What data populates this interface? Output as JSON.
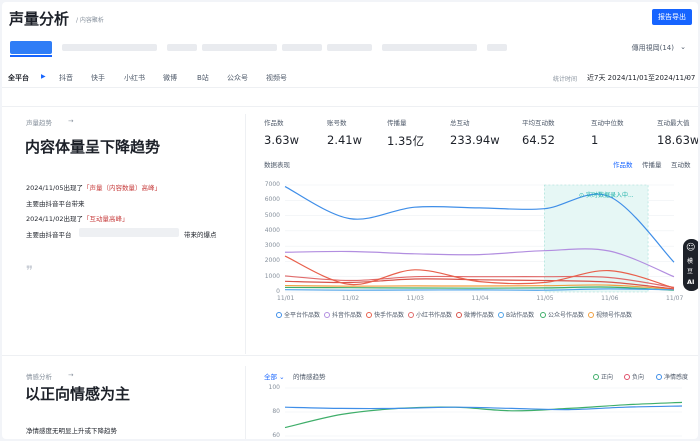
{
  "header": {
    "title": "声量分析",
    "subtitle": "/ 内容聚析",
    "export_label": "报告导出"
  },
  "accounts": {
    "selected_label": "傳用視岡(14)"
  },
  "tabs": [
    "全平台",
    "抖音",
    "快手",
    "小红书",
    "微博",
    "B站",
    "公众号",
    "视频号"
  ],
  "date": {
    "label": "统计时间",
    "range": "近7天  2024/11/01至2024/11/07"
  },
  "volume": {
    "tag": "声量趋势",
    "headline": "内容体量呈下降趋势",
    "bullets": [
      {
        "prefix": "2024/11/05出现了",
        "highlight": "「声量（内容数量）高峰」"
      },
      {
        "prefix": "主要由抖音平台带来",
        "highlight": ""
      },
      {
        "prefix": "2024/11/02出现了",
        "highlight": "「互动量高峰」"
      },
      {
        "prefix": "主要由抖音平台",
        "highlight": "",
        "suffix": "带来的爆点"
      }
    ],
    "stats": [
      {
        "label": "作品数",
        "value": "3.63w"
      },
      {
        "label": "账号数",
        "value": "2.41w"
      },
      {
        "label": "传播量",
        "value": "1.35亿"
      },
      {
        "label": "总互动",
        "value": "233.94w"
      },
      {
        "label": "平均互动数",
        "value": "64.52"
      },
      {
        "label": "互动中位数",
        "value": "1"
      },
      {
        "label": "互动最大值",
        "value": "18.63w"
      }
    ],
    "chart_title": "数据表现",
    "metric_tabs": [
      "作品数",
      "传播量",
      "互动数"
    ],
    "live_badge": "实时数据录入中..."
  },
  "chart_data": [
    {
      "type": "line",
      "title": "数据表现",
      "x": [
        "11/01",
        "11/02",
        "11/03",
        "11/04",
        "11/05",
        "11/06",
        "11/07"
      ],
      "ylim": [
        0,
        7000
      ],
      "yticks": [
        0,
        1000,
        2000,
        3000,
        4000,
        5000,
        6000,
        7000
      ],
      "legend_position": "bottom",
      "series": [
        {
          "name": "全平台作品数",
          "color": "#3f8ee8",
          "values": [
            6900,
            4800,
            5550,
            5500,
            5450,
            6250,
            1950
          ]
        },
        {
          "name": "抖音作品数",
          "color": "#b28ee0",
          "values": [
            2600,
            2650,
            2500,
            2450,
            2700,
            2680,
            1000
          ]
        },
        {
          "name": "快手作品数",
          "color": "#e8604c",
          "values": [
            2350,
            500,
            1450,
            680,
            620,
            1400,
            260
          ]
        },
        {
          "name": "小红书作品数",
          "color": "#e06b6b",
          "values": [
            1050,
            750,
            1000,
            1000,
            1000,
            950,
            300
          ]
        },
        {
          "name": "微博作品数",
          "color": "#d8534a",
          "values": [
            700,
            620,
            850,
            800,
            750,
            650,
            200
          ]
        },
        {
          "name": "B站作品数",
          "color": "#4fa3e8",
          "values": [
            150,
            120,
            130,
            140,
            120,
            200,
            150
          ]
        },
        {
          "name": "公众号作品数",
          "color": "#3fae6a",
          "values": [
            300,
            280,
            260,
            250,
            270,
            320,
            120
          ]
        },
        {
          "name": "视频号作品数",
          "color": "#f0a040",
          "values": [
            420,
            380,
            400,
            390,
            410,
            450,
            180
          ]
        }
      ]
    },
    {
      "type": "line",
      "title": "的情感趋势",
      "ylim": [
        60,
        100
      ],
      "yticks": [
        60,
        80,
        100
      ],
      "legend_position": "top-right",
      "series": [
        {
          "name": "正向",
          "color": "#3fae6a",
          "values": [
            67,
            78,
            83,
            84,
            81,
            83,
            86,
            88
          ]
        },
        {
          "name": "负向",
          "color": "#e0506a",
          "values": []
        },
        {
          "name": "净情感度",
          "color": "#3f8ee8",
          "values": [
            84,
            83,
            83,
            84,
            83,
            82,
            84,
            85
          ]
        }
      ]
    }
  ],
  "emotion": {
    "tag": "情感分析",
    "headline": "以正向情感为主",
    "line1": "净情感度无明显上升或下降趋势",
    "select": "全部",
    "title": "的情感趋势",
    "legend": [
      "正向",
      "负向",
      "净情感度"
    ]
  },
  "float_tool": {
    "line1": "模",
    "line2": "豆",
    "line3": "AI"
  },
  "colors": {
    "accent": "#1664ff",
    "live": "#20b2aa"
  }
}
